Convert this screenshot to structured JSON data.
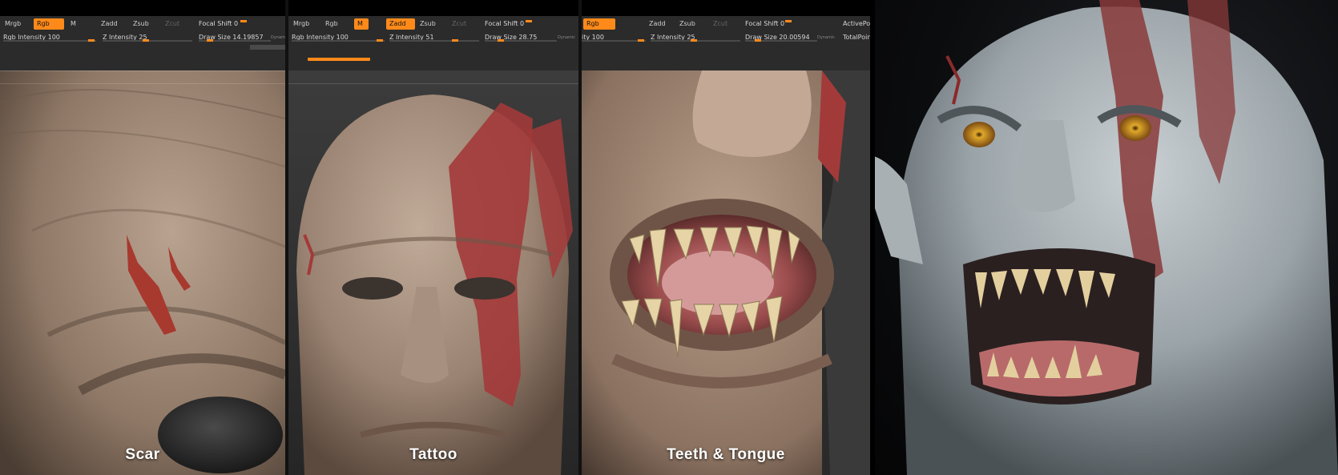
{
  "panels": [
    {
      "label": "Scar",
      "toolbar": {
        "mrgb": "Mrgb",
        "rgb": "Rgb",
        "m": "M",
        "zadd": "Zadd",
        "zsub": "Zsub",
        "zcut": "Zcut",
        "focal_shift": "Focal Shift 0",
        "rgb_intensity": "Rgb Intensity 100",
        "z_intensity": "Z Intensity 25",
        "draw_size": "Draw Size 14.19857",
        "dynamic": "Dynamic"
      }
    },
    {
      "label": "Tattoo",
      "toolbar": {
        "mrgb": "Mrgb",
        "rgb": "Rgb",
        "m": "M",
        "zadd": "Zadd",
        "zsub": "Zsub",
        "zcut": "Zcut",
        "focal_shift": "Focal Shift 0",
        "rgb_intensity": "Rgb Intensity 100",
        "z_intensity": "Z Intensity 51",
        "draw_size": "Draw Size 28.75",
        "dynamic": "Dynamic"
      }
    },
    {
      "label": "Teeth & Tongue",
      "toolbar": {
        "rgb": "Rgb",
        "zadd": "Zadd",
        "zsub": "Zsub",
        "zcut": "Zcut",
        "focal_shift": "Focal Shift 0",
        "rgb_intensity": "ity 100",
        "z_intensity": "Z Intensity 25",
        "draw_size": "Draw Size 20.00594",
        "dynamic": "Dynamic",
        "active_points": "ActivePoi",
        "total_points": "TotalPoin"
      }
    }
  ],
  "colors": {
    "accent": "#ff8a1a",
    "toolbar_bg": "#2b2b2b",
    "skin": "#b9a18c",
    "tattoo": "#a33a3a"
  }
}
